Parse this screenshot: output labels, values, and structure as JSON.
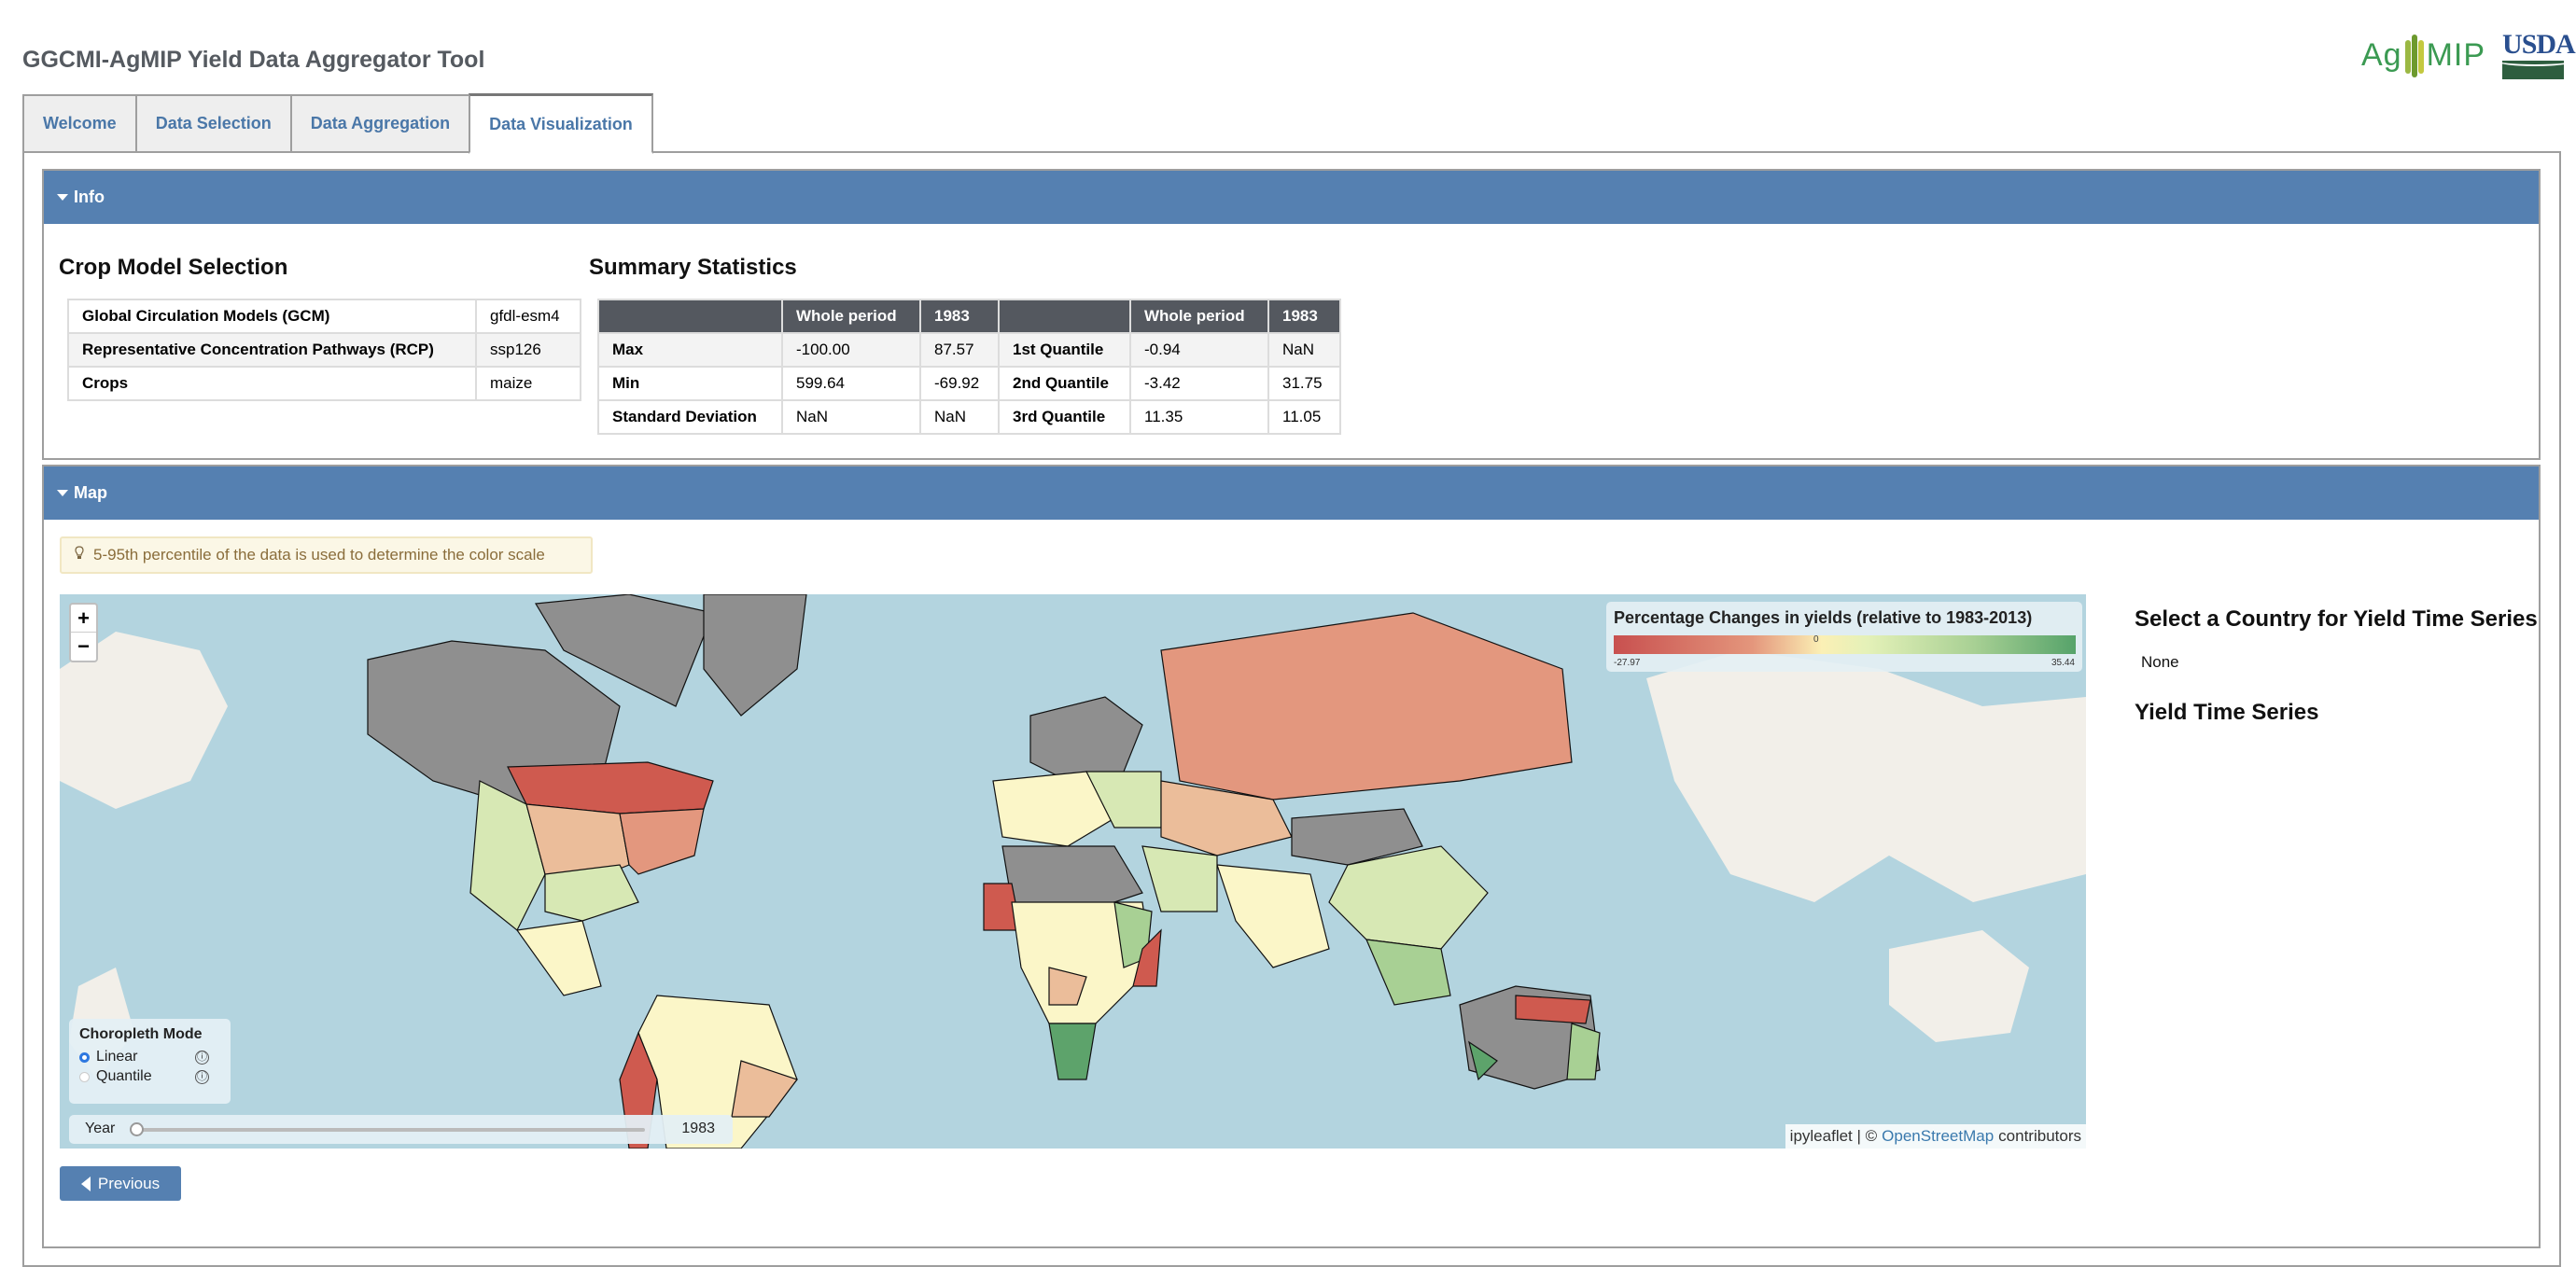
{
  "app": {
    "title": "GGCMI-AgMIP Yield Data Aggregator Tool",
    "logos": [
      {
        "name": "agmip-logo",
        "text_left": "Ag",
        "text_right": "MIP"
      },
      {
        "name": "usda-logo",
        "text": "USDA"
      }
    ]
  },
  "tabs": [
    {
      "label": "Welcome",
      "active": false
    },
    {
      "label": "Data Selection",
      "active": false
    },
    {
      "label": "Data Aggregation",
      "active": false
    },
    {
      "label": "Data Visualization",
      "active": true
    }
  ],
  "info": {
    "header": "Info",
    "crop_model": {
      "title": "Crop Model Selection",
      "rows": [
        {
          "key": "Global Circulation Models (GCM)",
          "value": "gfdl-esm4"
        },
        {
          "key": "Representative Concentration Pathways (RCP)",
          "value": "ssp126"
        },
        {
          "key": "Crops",
          "value": "maize"
        }
      ]
    },
    "summary": {
      "title": "Summary Statistics",
      "columns": [
        "",
        "Whole period",
        "1983"
      ],
      "table1": [
        {
          "label": "Max",
          "whole": "-100.00",
          "year": "87.57"
        },
        {
          "label": "Min",
          "whole": "599.64",
          "year": "-69.92"
        },
        {
          "label": "Standard Deviation",
          "whole": "NaN",
          "year": "NaN"
        }
      ],
      "table2": [
        {
          "label": "1st Quantile",
          "whole": "-0.94",
          "year": "NaN"
        },
        {
          "label": "2nd Quantile",
          "whole": "-3.42",
          "year": "31.75"
        },
        {
          "label": "3rd Quantile",
          "whole": "11.35",
          "year": "11.05"
        }
      ]
    }
  },
  "map_section": {
    "header": "Map",
    "tip": "5-95th percentile of the data is used to determine the color scale",
    "tip_icon": "lightbulb-icon",
    "zoom_in": "+",
    "zoom_out": "−",
    "legend": {
      "title": "Percentage Changes in yields (relative to 1983-2013)",
      "min": "-27.97",
      "mid": "0",
      "max": "35.44",
      "colors": {
        "low": "#c8504f",
        "mid": "#fbf0b5",
        "high": "#56a36a"
      }
    },
    "choropleth": {
      "title": "Choropleth Mode",
      "options": [
        {
          "label": "Linear",
          "selected": true,
          "info": "ⓘ"
        },
        {
          "label": "Quantile",
          "selected": false,
          "info": "ⓘ"
        }
      ]
    },
    "year_slider": {
      "label": "Year",
      "value": "1983",
      "fraction": 0.0
    },
    "attribution": {
      "prefix": "ipyleaflet | ©",
      "link": "OpenStreetMap",
      "suffix": "contributors"
    },
    "colors": {
      "ocean": "#b3d4df",
      "nodata": "#8f8f8f",
      "red": "#cf5a4f",
      "salmon": "#e3977e",
      "peach": "#ebbd9a",
      "cream": "#fbf6c8",
      "lightgreen": "#d7e8b4",
      "green": "#a8d094",
      "darkgreen": "#5da36b",
      "land": "#f2efe9"
    }
  },
  "side": {
    "select_title": "Select a Country for Yield Time Series",
    "selected_country": "None",
    "timeseries_title": "Yield Time Series"
  },
  "nav": {
    "previous": "Previous"
  },
  "theme": {
    "accent": "#5580b1",
    "tab_text": "#4a77a8",
    "table_header": "#54585f"
  }
}
